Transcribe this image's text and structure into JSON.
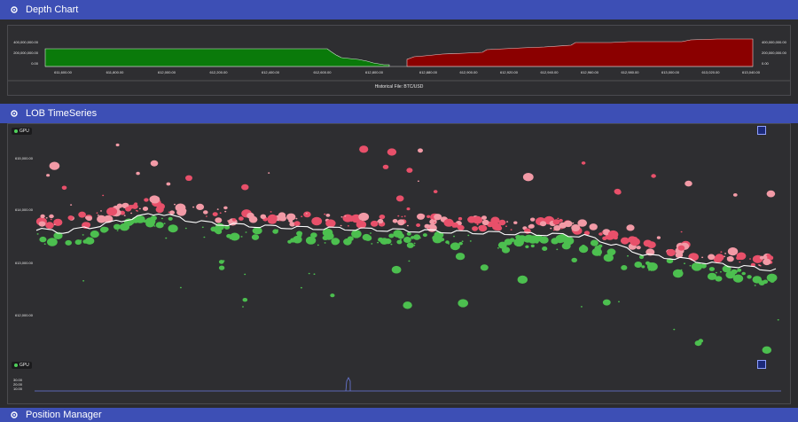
{
  "panels": {
    "depth_title": "Depth Chart",
    "lob_title": "LOB TimeSeries",
    "position_title": "Position Manager"
  },
  "depth": {
    "left_yticks": [
      "400,000,000.00",
      "200,000,000.00",
      "0.00"
    ],
    "right_yticks": [
      "400,000,000.00",
      "200,000,000.00",
      "0.00"
    ],
    "bid_xticks": [
      "611,600.00",
      "611,800.00",
      "612,000.00",
      "612,200.00",
      "612,400.00",
      "612,600.00",
      "612,800.00"
    ],
    "ask_xticks": [
      "612,880.00",
      "612,900.00",
      "612,920.00",
      "612,940.00",
      "612,960.00",
      "612,980.00",
      "613,000.00",
      "613,020.00",
      "613,040.00"
    ],
    "caption": "Historical File: BTC/USD",
    "bid_color": "#0a7a0a",
    "ask_color": "#8b0000"
  },
  "lob": {
    "gpu_label": "GPU",
    "gpu_label_2": "GPU",
    "yticks": [
      "615,000.00",
      "614,000.00",
      "613,000.00",
      "612,000.00"
    ],
    "volume_ticks": [
      "30.00",
      "20.00",
      "10.00"
    ],
    "ask_color": "#e8506a",
    "ask_light_color": "#f29aa6",
    "bid_color": "#4cbf4f",
    "mid_line_color": "#ffffff"
  }
}
